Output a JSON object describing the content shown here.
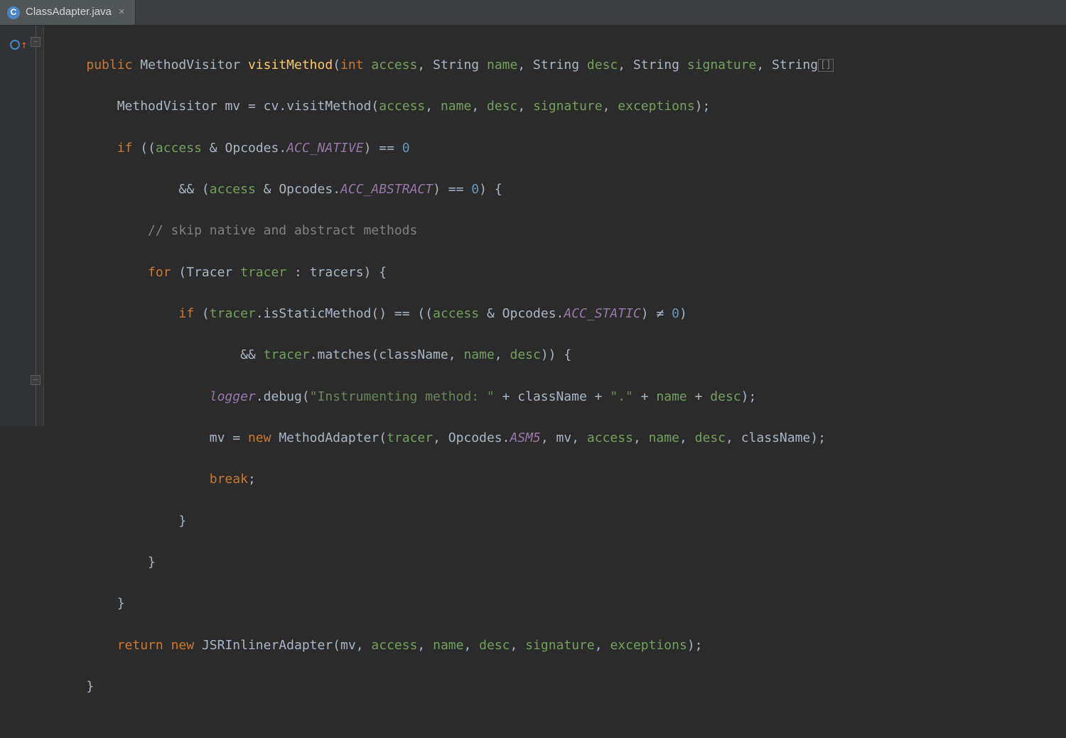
{
  "tab": {
    "fileName": "ClassAdapter.java",
    "iconLetter": "C",
    "close": "×"
  },
  "gutter": {
    "overrideTooltip": "Overrides method",
    "foldCollapse": "−",
    "foldExpand": "+"
  },
  "code": {
    "l1": {
      "kw_public": "public",
      "type_mv": "MethodVisitor",
      "meth": "visitMethod",
      "kw_int": "int",
      "p_access": "access",
      "t_string": "String",
      "p_name": "name",
      "p_desc": "desc",
      "p_sig": "signature",
      "trailEllipsis": "[]"
    },
    "l2": {
      "type_mv": "MethodVisitor",
      "v_mv": "mv",
      "v_cv": "cv",
      "call": "visitMethod",
      "a1": "access",
      "a2": "name",
      "a3": "desc",
      "a4": "signature",
      "a5": "exceptions"
    },
    "l3": {
      "kw_if": "if",
      "v_access": "access",
      "t_opcodes": "Opcodes",
      "const": "ACC_NATIVE",
      "eq": "==",
      "zero": "0"
    },
    "l4": {
      "and": "&&",
      "v_access": "access",
      "t_opcodes": "Opcodes",
      "const": "ACC_ABSTRACT",
      "eq": "==",
      "zero": "0"
    },
    "l5": {
      "comment": "// skip native and abstract methods"
    },
    "l6": {
      "kw_for": "for",
      "t_tracer": "Tracer",
      "v_tracer": "tracer",
      "v_tracers": "tracers"
    },
    "l7": {
      "kw_if": "if",
      "v_tracer": "tracer",
      "call1": "isStaticMethod",
      "eq": "==",
      "v_access": "access",
      "t_opcodes": "Opcodes",
      "const": "ACC_STATIC",
      "neq": "≠",
      "zero": "0"
    },
    "l8": {
      "and": "&&",
      "v_tracer": "tracer",
      "call": "matches",
      "a1": "className",
      "a2": "name",
      "a3": "desc"
    },
    "l9": {
      "logger": "logger",
      "call": "debug",
      "s1": "\"Instrumenting method: \"",
      "plus": "+",
      "v_cn": "className",
      "s2": "\".\"",
      "v_name": "name",
      "v_desc": "desc"
    },
    "l10": {
      "v_mv": "mv",
      "kw_new": "new",
      "t_ma": "MethodAdapter",
      "a1": "tracer",
      "t_op": "Opcodes",
      "const": "ASM5",
      "a3": "mv",
      "a4": "access",
      "a5": "name",
      "a6": "desc",
      "a7": "className"
    },
    "l11": {
      "kw": "break"
    },
    "l12": {
      "brace": "}"
    },
    "l13": {
      "brace": "}"
    },
    "l14": {
      "brace": "}"
    },
    "l15": {
      "kw_return": "return",
      "kw_new": "new",
      "t": "JSRInlinerAdapter",
      "a1": "mv",
      "a2": "access",
      "a3": "name",
      "a4": "desc",
      "a5": "signature",
      "a6": "exceptions"
    },
    "l16": {
      "brace": "}"
    }
  }
}
